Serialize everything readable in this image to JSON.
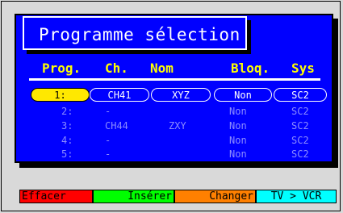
{
  "title": "Programme sélection",
  "headers": {
    "prog": "Prog.",
    "ch": "Ch.",
    "nom": "Nom",
    "bloq": "Bloq.",
    "sys": "Sys"
  },
  "rows": [
    {
      "prog": "1:",
      "ch": "CH41",
      "nom": "XYZ",
      "bloq": "Non",
      "sys": "SC2",
      "selected": true
    },
    {
      "prog": "2:",
      "ch": "-",
      "nom": "",
      "bloq": "Non",
      "sys": "SC2"
    },
    {
      "prog": "3:",
      "ch": "CH44",
      "nom": "ZXY",
      "bloq": "Non",
      "sys": "SC2"
    },
    {
      "prog": "4:",
      "ch": "-",
      "nom": "",
      "bloq": "Non",
      "sys": "SC2"
    },
    {
      "prog": "5:",
      "ch": "-",
      "nom": "",
      "bloq": "Non",
      "sys": "SC2"
    }
  ],
  "buttons": {
    "effacer": {
      "label": "Effacer",
      "color": "#ff0000"
    },
    "inserer": {
      "label": "Insérer",
      "color": "#00ff00"
    },
    "changer": {
      "label": "Changer",
      "color": "#ff8000"
    },
    "tvvcr": {
      "label": "TV > VCR",
      "color": "#00ffff"
    }
  }
}
